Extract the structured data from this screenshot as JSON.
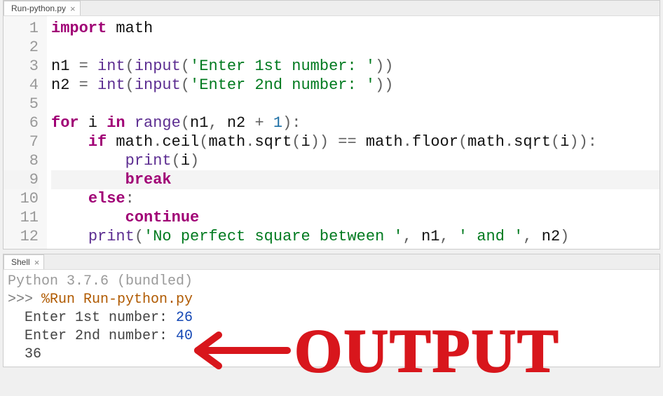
{
  "editor": {
    "tab_label": "Run-python.py",
    "lines": [
      {
        "n": 1,
        "tokens": [
          [
            "kw",
            "import"
          ],
          [
            "py",
            " math"
          ]
        ]
      },
      {
        "n": 2,
        "tokens": []
      },
      {
        "n": 3,
        "tokens": [
          [
            "id",
            "n1 "
          ],
          [
            "op",
            "= "
          ],
          [
            "fn",
            "int"
          ],
          [
            "op",
            "("
          ],
          [
            "fn",
            "input"
          ],
          [
            "op",
            "("
          ],
          [
            "str",
            "'Enter 1st number: '"
          ],
          [
            "op",
            "))"
          ]
        ]
      },
      {
        "n": 4,
        "tokens": [
          [
            "id",
            "n2 "
          ],
          [
            "op",
            "= "
          ],
          [
            "fn",
            "int"
          ],
          [
            "op",
            "("
          ],
          [
            "fn",
            "input"
          ],
          [
            "op",
            "("
          ],
          [
            "str",
            "'Enter 2nd number: '"
          ],
          [
            "op",
            "))"
          ]
        ]
      },
      {
        "n": 5,
        "tokens": []
      },
      {
        "n": 6,
        "tokens": [
          [
            "kw",
            "for"
          ],
          [
            "id",
            " i "
          ],
          [
            "kw",
            "in"
          ],
          [
            "py",
            " "
          ],
          [
            "fn",
            "range"
          ],
          [
            "op",
            "("
          ],
          [
            "id",
            "n1"
          ],
          [
            "op",
            ", "
          ],
          [
            "id",
            "n2 "
          ],
          [
            "op",
            "+ "
          ],
          [
            "num",
            "1"
          ],
          [
            "op",
            "):"
          ]
        ]
      },
      {
        "n": 7,
        "tokens": [
          [
            "py",
            "    "
          ],
          [
            "kw",
            "if"
          ],
          [
            "py",
            " math"
          ],
          [
            "op",
            "."
          ],
          [
            "id",
            "ceil"
          ],
          [
            "op",
            "("
          ],
          [
            "py",
            "math"
          ],
          [
            "op",
            "."
          ],
          [
            "id",
            "sqrt"
          ],
          [
            "op",
            "("
          ],
          [
            "id",
            "i"
          ],
          [
            "op",
            ")) == "
          ],
          [
            "py",
            "math"
          ],
          [
            "op",
            "."
          ],
          [
            "id",
            "floor"
          ],
          [
            "op",
            "("
          ],
          [
            "py",
            "math"
          ],
          [
            "op",
            "."
          ],
          [
            "id",
            "sqrt"
          ],
          [
            "op",
            "("
          ],
          [
            "id",
            "i"
          ],
          [
            "op",
            ")):"
          ]
        ]
      },
      {
        "n": 8,
        "tokens": [
          [
            "py",
            "        "
          ],
          [
            "fn",
            "print"
          ],
          [
            "op",
            "("
          ],
          [
            "id",
            "i"
          ],
          [
            "op",
            ")"
          ]
        ]
      },
      {
        "n": 9,
        "tokens": [
          [
            "py",
            "        "
          ],
          [
            "kw",
            "break"
          ]
        ],
        "current": true
      },
      {
        "n": 10,
        "tokens": [
          [
            "py",
            "    "
          ],
          [
            "kw",
            "else"
          ],
          [
            "op",
            ":"
          ]
        ]
      },
      {
        "n": 11,
        "tokens": [
          [
            "py",
            "        "
          ],
          [
            "kw",
            "continue"
          ]
        ]
      },
      {
        "n": 12,
        "tokens": [
          [
            "py",
            "    "
          ],
          [
            "fn",
            "print"
          ],
          [
            "op",
            "("
          ],
          [
            "str",
            "'No perfect square between '"
          ],
          [
            "op",
            ", "
          ],
          [
            "id",
            "n1"
          ],
          [
            "op",
            ", "
          ],
          [
            "str",
            "' and '"
          ],
          [
            "op",
            ", "
          ],
          [
            "id",
            "n2"
          ],
          [
            "op",
            ")"
          ]
        ]
      }
    ]
  },
  "shell": {
    "tab_label": "Shell",
    "version": "Python 3.7.6 (bundled)",
    "prompt": ">>> ",
    "command": "%Run Run-python.py",
    "io": [
      {
        "prompt": "  Enter 1st number: ",
        "value": "26"
      },
      {
        "prompt": "  Enter 2nd number: ",
        "value": "40"
      }
    ],
    "result": "  36"
  },
  "annotation": {
    "label": "OUTPUT",
    "color": "#d8161c"
  }
}
